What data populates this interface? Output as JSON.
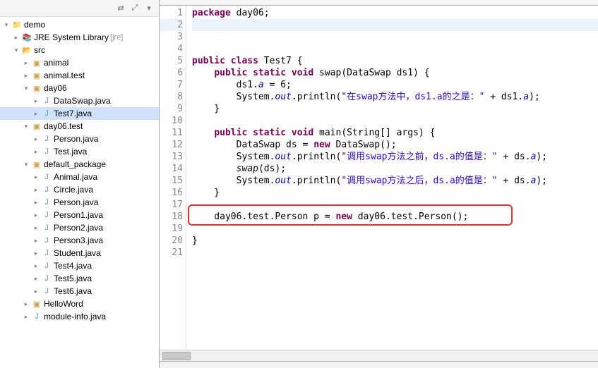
{
  "tree": {
    "project": "demo",
    "jre_label": "JRE System Library",
    "jre_suffix": "[jre]",
    "src": "src",
    "pkgs": {
      "animal": "animal",
      "animal_test": "animal.test",
      "day06": "day06",
      "day06_files": [
        "DataSwap.java",
        "Test7.java"
      ],
      "day06_test": "day06.test",
      "day06_test_files": [
        "Person.java",
        "Test.java"
      ],
      "default_pkg": "default_package",
      "default_files": [
        "Animal.java",
        "Circle.java",
        "Person.java",
        "Person1.java",
        "Person2.java",
        "Person3.java",
        "Student.java",
        "Test4.java",
        "Test5.java",
        "Test6.java"
      ],
      "helloword": "HelloWord",
      "module_info": "module-info.java"
    }
  },
  "code": {
    "lines": {
      "l1_kw": "package",
      "l1_rest": " day06;",
      "l5_kw": "public class",
      "l5_rest": " Test7 {",
      "l6_kw1": "public static void",
      "l6_rest": " swap(DataSwap ds1) {",
      "l7": "        ds1.",
      "l7_fld": "a",
      "l7_b": " = 6;",
      "l8_a": "        System.",
      "l8_out": "out",
      "l8_b": ".println(",
      "l8_str": "\"在swap方法中，ds1.a的之是：\"",
      "l8_c": " + ds1.",
      "l8_fld": "a",
      "l8_d": ");",
      "l9": "    }",
      "l11_kw": "public static void",
      "l11_rest": " main(String[] args) {",
      "l12_a": "        DataSwap ds = ",
      "l12_new": "new",
      "l12_b": " DataSwap();",
      "l13_a": "        System.",
      "l13_out": "out",
      "l13_b": ".println(",
      "l13_str": "\"调用swap方法之前，ds.a的值是：\"",
      "l13_c": " + ds.",
      "l13_fld": "a",
      "l13_d": ");",
      "l14_a": "        ",
      "l14_i": "swap",
      "l14_b": "(ds);",
      "l15_a": "        System.",
      "l15_out": "out",
      "l15_b": ".println(",
      "l15_str": "\"调用swap方法之后，ds.a的值是：\"",
      "l15_c": " + ds.",
      "l15_fld": "a",
      "l15_d": ");",
      "l16": "    }",
      "l18_a": "    day06.test.Person p = ",
      "l18_new": "new",
      "l18_b": " day06.test.Person();",
      "l20": "}"
    },
    "line_numbers": [
      "1",
      "2",
      "3",
      "4",
      "5",
      "6",
      "7",
      "8",
      "9",
      "10",
      "11",
      "12",
      "13",
      "14",
      "15",
      "16",
      "17",
      "18",
      "19",
      "20",
      "21"
    ]
  }
}
